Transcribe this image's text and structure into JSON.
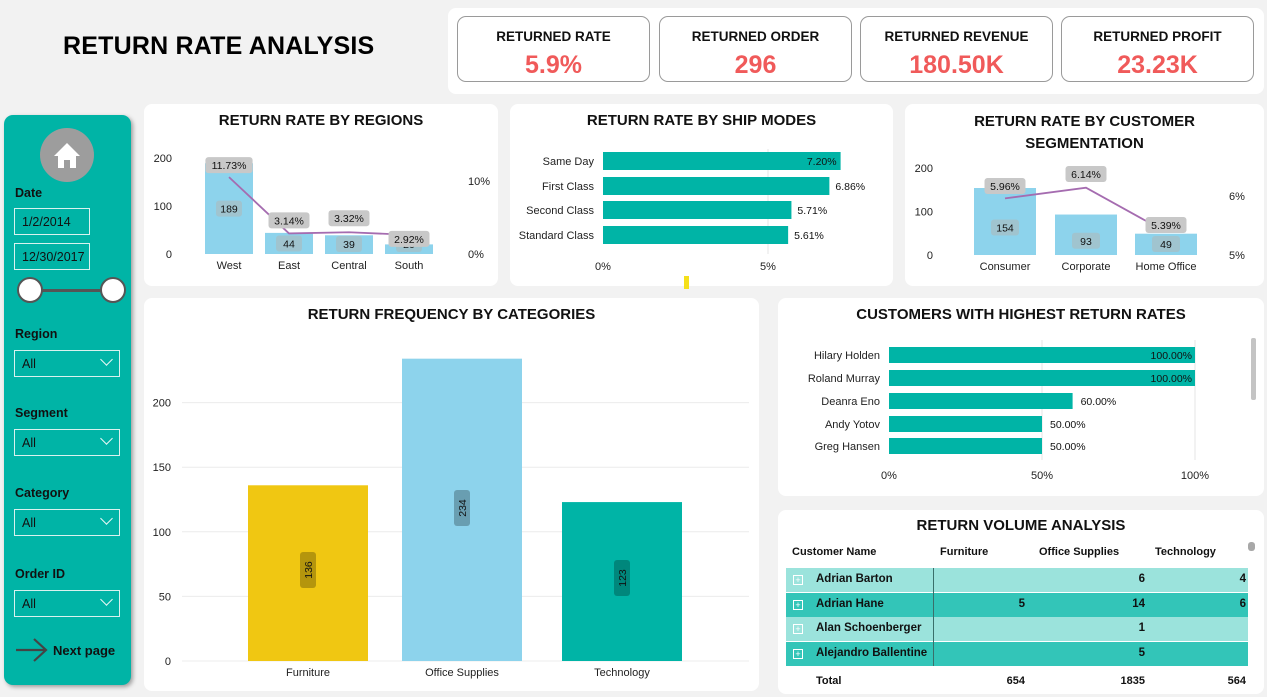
{
  "title": "RETURN RATE ANALYSIS",
  "kpis": [
    {
      "label": "RETURNED RATE",
      "value": "5.9%"
    },
    {
      "label": "RETURNED ORDER",
      "value": "296"
    },
    {
      "label": "RETURNED REVENUE",
      "value": "180.50K"
    },
    {
      "label": "RETURNED PROFIT",
      "value": "23.23K"
    }
  ],
  "sidebar": {
    "home_icon": "home-icon",
    "date_label": "Date",
    "date_start": "1/2/2014",
    "date_end": "12/30/2017",
    "region_label": "Region",
    "region_value": "All",
    "segment_label": "Segment",
    "segment_value": "All",
    "category_label": "Category",
    "category_value": "All",
    "order_label": "Order ID",
    "order_value": "All",
    "next_label": "Next page"
  },
  "colors": {
    "teal": "#00b4a6",
    "lightblue": "#8dd3ec",
    "yellow": "#f0c712",
    "line": "#a56cb0",
    "kpi_value": "#f05a5a"
  },
  "chart_data": [
    {
      "id": "regions",
      "title": "RETURN RATE BY REGIONS",
      "type": "bar",
      "categories": [
        "West",
        "East",
        "Central",
        "South"
      ],
      "values": [
        189,
        44,
        39,
        20
      ],
      "rate_labels": [
        "11.73%",
        "3.14%",
        "3.32%",
        "2.92%"
      ],
      "rates": [
        11.73,
        3.14,
        3.32,
        2.92
      ],
      "y_ticks": [
        "200",
        "100",
        "0"
      ],
      "y2_ticks": [
        "10%",
        "0%"
      ],
      "ylim": [
        0,
        200
      ]
    },
    {
      "id": "shipmodes",
      "title": "RETURN RATE BY SHIP MODES",
      "type": "bar",
      "categories": [
        "Same Day",
        "First Class",
        "Second Class",
        "Standard Class"
      ],
      "values": [
        7.2,
        6.86,
        5.71,
        5.61
      ],
      "value_labels": [
        "7.20%",
        "6.86%",
        "5.71%",
        "5.61%"
      ],
      "x_ticks": [
        "0%",
        "5%"
      ]
    },
    {
      "id": "segments",
      "title": "RETURN RATE BY CUSTOMER SEGMENTATION",
      "type": "bar",
      "categories": [
        "Consumer",
        "Corporate",
        "Home Office"
      ],
      "values": [
        154,
        93,
        49
      ],
      "rate_labels": [
        "5.96%",
        "6.14%",
        "5.39%"
      ],
      "rates": [
        5.96,
        6.14,
        5.39
      ],
      "y_ticks": [
        "200",
        "100",
        "0"
      ],
      "y2_ticks": [
        "6%",
        "5%"
      ]
    },
    {
      "id": "categories",
      "title": "RETURN FREQUENCY BY CATEGORIES",
      "type": "bar",
      "categories": [
        "Furniture",
        "Office Supplies",
        "Technology"
      ],
      "values": [
        136,
        234,
        123
      ],
      "y_ticks": [
        "200",
        "150",
        "100",
        "50",
        "0"
      ],
      "ylim": [
        0,
        250
      ]
    },
    {
      "id": "customers",
      "title": "CUSTOMERS WITH HIGHEST RETURN RATES",
      "type": "bar",
      "categories": [
        "Hilary Holden",
        "Roland Murray",
        "Deanra Eno",
        "Andy Yotov",
        "Greg Hansen"
      ],
      "values": [
        100,
        100,
        60,
        50,
        50
      ],
      "value_labels": [
        "100.00%",
        "100.00%",
        "60.00%",
        "50.00%",
        "50.00%"
      ],
      "x_ticks": [
        "0%",
        "50%",
        "100%"
      ]
    },
    {
      "id": "volume",
      "title": "RETURN VOLUME ANALYSIS",
      "type": "table",
      "columns": [
        "Customer Name",
        "Furniture",
        "Office Supplies",
        "Technology"
      ],
      "rows": [
        [
          "Adrian Barton",
          "",
          "6",
          "4"
        ],
        [
          "Adrian Hane",
          "5",
          "14",
          "6"
        ],
        [
          "Alan Schoenberger",
          "",
          "1",
          ""
        ],
        [
          "Alejandro Ballentine",
          "",
          "5",
          ""
        ]
      ],
      "total": [
        "Total",
        "654",
        "1835",
        "564"
      ]
    }
  ]
}
